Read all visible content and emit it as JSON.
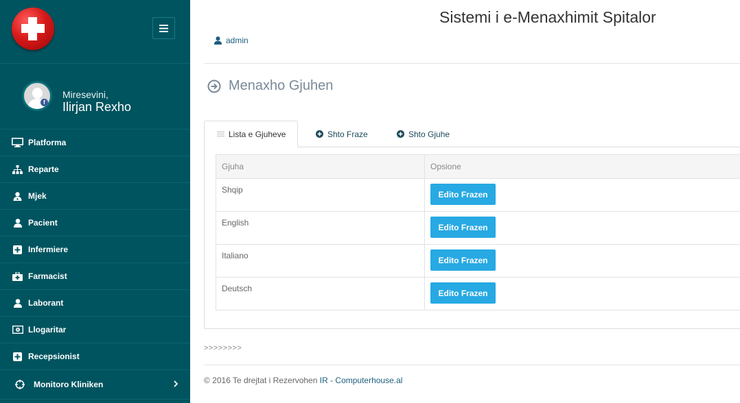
{
  "header": {
    "system_title": "Sistemi i e-Menaxhimit Spitalor",
    "user": "admin"
  },
  "sidebar": {
    "welcome": "Miresevini,",
    "username": "Ilirjan Rexho",
    "items": [
      {
        "label": "Platforma",
        "icon": "monitor-icon"
      },
      {
        "label": "Reparte",
        "icon": "sitemap-icon"
      },
      {
        "label": "Mjek",
        "icon": "user-md-icon"
      },
      {
        "label": "Pacient",
        "icon": "user-icon"
      },
      {
        "label": "Infermiere",
        "icon": "plus-square-icon"
      },
      {
        "label": "Farmacist",
        "icon": "medkit-icon"
      },
      {
        "label": "Laborant",
        "icon": "user-icon"
      },
      {
        "label": "Llogaritar",
        "icon": "money-icon"
      },
      {
        "label": "Recepsionist",
        "icon": "plus-square-icon"
      },
      {
        "label": "Monitoro Kliniken",
        "icon": "crosshair-icon"
      }
    ]
  },
  "page": {
    "heading": "Menaxho Gjuhen"
  },
  "tabs": [
    {
      "label": "Lista e Gjuheve",
      "icon": "list-icon",
      "active": true
    },
    {
      "label": "Shto Fraze",
      "icon": "plus-circle-icon",
      "active": false
    },
    {
      "label": "Shto Gjuhe",
      "icon": "plus-circle-icon",
      "active": false
    }
  ],
  "table": {
    "headers": [
      "Gjuha",
      "Opsione"
    ],
    "rows": [
      {
        "language": "Shqip",
        "action": "Edito Frazen"
      },
      {
        "language": "English",
        "action": "Edito Frazen"
      },
      {
        "language": "Italiano",
        "action": "Edito Frazen"
      },
      {
        "language": "Deutsch",
        "action": "Edito Frazen"
      }
    ]
  },
  "footer": {
    "arrows": ">>>>>>>>",
    "copyright": "© 2016 Te drejtat i Rezervohen",
    "link": "IR - Computerhouse.al"
  },
  "colors": {
    "sidebar": "#00545f",
    "button": "#27a9e3",
    "link": "#1c5e7d"
  }
}
